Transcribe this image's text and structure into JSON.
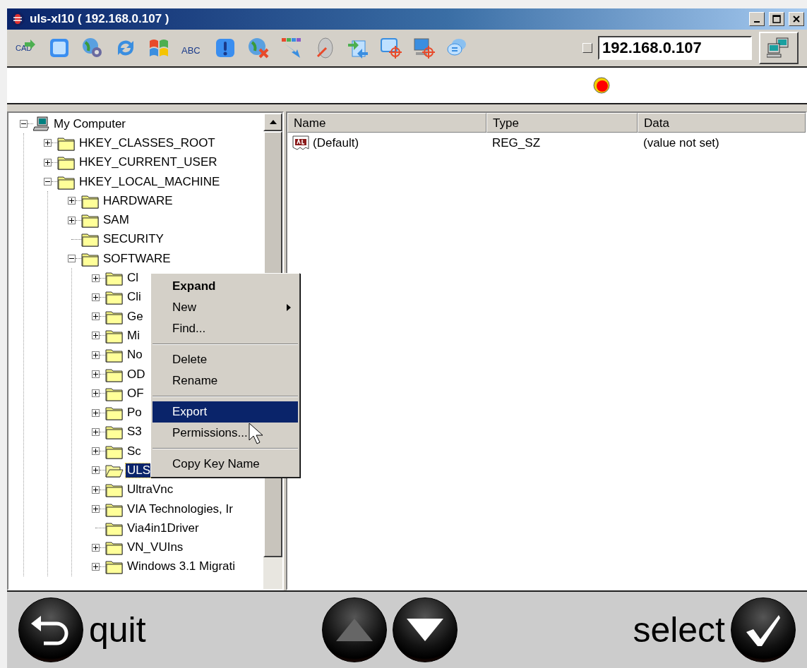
{
  "window": {
    "title": "uls-xl10 ( 192.168.0.107 )"
  },
  "toolbar": [
    {
      "kind": "cad",
      "glyph": "CAD"
    },
    {
      "kind": "windows"
    },
    {
      "kind": "globe-gear"
    },
    {
      "kind": "refresh"
    },
    {
      "kind": "flag"
    },
    {
      "kind": "abc",
      "glyph": "ABC"
    },
    {
      "kind": "info"
    },
    {
      "kind": "globe-x"
    },
    {
      "kind": "arrow"
    },
    {
      "kind": "mouse"
    },
    {
      "kind": "swap"
    },
    {
      "kind": "window-target"
    },
    {
      "kind": "monitor-target"
    },
    {
      "kind": "chat"
    }
  ],
  "address": {
    "checked": false,
    "value": "192.168.0.107"
  },
  "tree": [
    {
      "label": "My Computer",
      "kind": "computer",
      "expandable": true,
      "expanded": true,
      "selected": false,
      "children": [
        {
          "label": "HKEY_CLASSES_ROOT",
          "kind": "folder",
          "expandable": true,
          "expanded": false,
          "selected": false
        },
        {
          "label": "HKEY_CURRENT_USER",
          "kind": "folder",
          "expandable": true,
          "expanded": false,
          "selected": false
        },
        {
          "label": "HKEY_LOCAL_MACHINE",
          "kind": "folder",
          "expandable": true,
          "expanded": true,
          "selected": false,
          "children": [
            {
              "label": "HARDWARE",
              "kind": "folder",
              "expandable": true,
              "expanded": false,
              "selected": false
            },
            {
              "label": "SAM",
              "kind": "folder",
              "expandable": true,
              "expanded": false,
              "selected": false
            },
            {
              "label": "SECURITY",
              "kind": "folder",
              "expandable": false,
              "selected": false
            },
            {
              "label": "SOFTWARE",
              "kind": "folder",
              "expandable": true,
              "expanded": true,
              "selected": false,
              "children": [
                {
                  "label": "Cl",
                  "kind": "folder",
                  "expandable": true,
                  "expanded": false,
                  "selected": false
                },
                {
                  "label": "Cli",
                  "kind": "folder",
                  "expandable": true,
                  "expanded": false,
                  "selected": false
                },
                {
                  "label": "Ge",
                  "kind": "folder",
                  "expandable": true,
                  "expanded": false,
                  "selected": false
                },
                {
                  "label": "Mi",
                  "kind": "folder",
                  "expandable": true,
                  "expanded": false,
                  "selected": false
                },
                {
                  "label": "No",
                  "kind": "folder",
                  "expandable": true,
                  "expanded": false,
                  "selected": false
                },
                {
                  "label": "OD",
                  "kind": "folder",
                  "expandable": true,
                  "expanded": false,
                  "selected": false
                },
                {
                  "label": "OF",
                  "kind": "folder",
                  "expandable": true,
                  "expanded": false,
                  "selected": false
                },
                {
                  "label": "Po",
                  "kind": "folder",
                  "expandable": true,
                  "expanded": false,
                  "selected": false
                },
                {
                  "label": "S3",
                  "kind": "folder",
                  "expandable": true,
                  "expanded": false,
                  "selected": false
                },
                {
                  "label": "Sc",
                  "kind": "folder",
                  "expandable": true,
                  "expanded": false,
                  "selected": false
                },
                {
                  "label": "ULS",
                  "kind": "folder",
                  "expandable": true,
                  "expanded": false,
                  "selected": true
                },
                {
                  "label": "UltraVnc",
                  "kind": "folder",
                  "expandable": true,
                  "expanded": false,
                  "selected": false
                },
                {
                  "label": "VIA Technologies, Ir",
                  "kind": "folder",
                  "expandable": true,
                  "expanded": false,
                  "selected": false
                },
                {
                  "label": "Via4in1Driver",
                  "kind": "folder",
                  "expandable": false,
                  "selected": false
                },
                {
                  "label": "VN_VUIns",
                  "kind": "folder",
                  "expandable": true,
                  "expanded": false,
                  "selected": false
                },
                {
                  "label": "Windows 3.1 Migrati",
                  "kind": "folder",
                  "expandable": true,
                  "expanded": false,
                  "selected": false
                }
              ]
            }
          ]
        }
      ]
    }
  ],
  "table": {
    "columns": [
      "Name",
      "Type",
      "Data"
    ],
    "rows": [
      {
        "name": "(Default)",
        "type": "REG_SZ",
        "data": "(value not set)"
      }
    ]
  },
  "context_menu": [
    {
      "kind": "item",
      "label": "Expand",
      "default": true,
      "submenu": false,
      "selected": false
    },
    {
      "kind": "item",
      "label": "New",
      "default": false,
      "submenu": true,
      "selected": false
    },
    {
      "kind": "item",
      "label": "Find...",
      "default": false,
      "submenu": false,
      "selected": false
    },
    {
      "kind": "separator"
    },
    {
      "kind": "item",
      "label": "Delete",
      "default": false,
      "submenu": false,
      "selected": false
    },
    {
      "kind": "item",
      "label": "Rename",
      "default": false,
      "submenu": false,
      "selected": false
    },
    {
      "kind": "separator"
    },
    {
      "kind": "item",
      "label": "Export",
      "default": false,
      "submenu": false,
      "selected": true
    },
    {
      "kind": "item",
      "label": "Permissions...",
      "default": false,
      "submenu": false,
      "selected": false
    },
    {
      "kind": "separator"
    },
    {
      "kind": "item",
      "label": "Copy Key Name",
      "default": false,
      "submenu": false,
      "selected": false
    }
  ],
  "bottom_bar": {
    "quit": {
      "label": "quit"
    },
    "up": {
      "disabled": true
    },
    "down": {
      "disabled": false
    },
    "select": {
      "label": "select"
    }
  }
}
